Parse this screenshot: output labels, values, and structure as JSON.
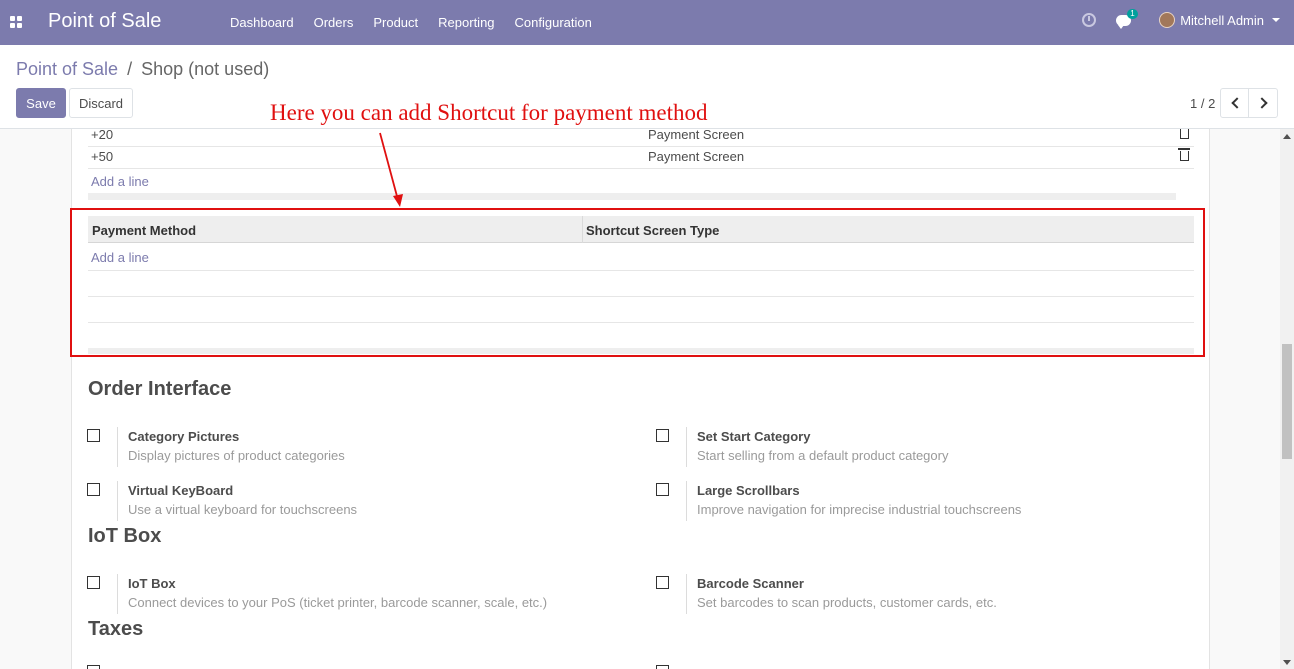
{
  "navbar": {
    "app_name": "Point of Sale",
    "menu": [
      "Dashboard",
      "Orders",
      "Product",
      "Reporting",
      "Configuration"
    ],
    "chat_count": "1",
    "user_name": "Mitchell Admin",
    "color": "#7c7bad"
  },
  "breadcrumb": {
    "parent": "Point of Sale",
    "separator": "/",
    "current": "Shop (not used)"
  },
  "buttons": {
    "save": "Save",
    "discard": "Discard"
  },
  "pager": {
    "value": "1 / 2"
  },
  "annotation": {
    "text": "Here you can add Shortcut for payment method",
    "color": "#e01010"
  },
  "amount_rows": [
    {
      "amount": "+20",
      "screen": "Payment Screen"
    },
    {
      "amount": "+50",
      "screen": "Payment Screen"
    }
  ],
  "add_line_label": "Add a line",
  "payment_table": {
    "columns": [
      "Payment Method",
      "Shortcut Screen Type"
    ],
    "add_line": "Add a line"
  },
  "sections": [
    {
      "title": "Order Interface",
      "settings": [
        {
          "label": "Category Pictures",
          "desc": "Display pictures of product categories",
          "checked": false
        },
        {
          "label": "Set Start Category",
          "desc": "Start selling from a default product category",
          "checked": false
        },
        {
          "label": "Virtual KeyBoard",
          "desc": "Use a virtual keyboard for touchscreens",
          "checked": false
        },
        {
          "label": "Large Scrollbars",
          "desc": "Improve navigation for imprecise industrial touchscreens",
          "checked": false
        }
      ]
    },
    {
      "title": "IoT Box",
      "settings": [
        {
          "label": "IoT Box",
          "desc": "Connect devices to your PoS (ticket printer, barcode scanner, scale, etc.)",
          "checked": false
        },
        {
          "label": "Barcode Scanner",
          "desc": "Set barcodes to scan products, customer cards, etc.",
          "checked": false
        }
      ]
    },
    {
      "title": "Taxes",
      "settings": []
    }
  ]
}
